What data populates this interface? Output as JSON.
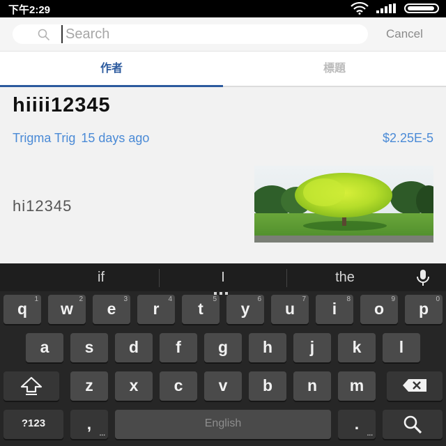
{
  "status_bar": {
    "time": "下午2:29"
  },
  "search": {
    "placeholder": "Search",
    "value": "",
    "cancel_label": "Cancel"
  },
  "tabs": [
    {
      "label": "作者",
      "selected": true
    },
    {
      "label": "標題",
      "selected": false
    }
  ],
  "post": {
    "title": "hiiii12345",
    "author": "Trigma Trig",
    "time_ago": "15 days ago",
    "price": "$2.25E-5",
    "excerpt": "hi12345",
    "thumbnail_icon": "tree-photo"
  },
  "keyboard": {
    "suggestions": [
      "if",
      "I",
      "the"
    ],
    "row1": [
      {
        "k": "q",
        "n": "1"
      },
      {
        "k": "w",
        "n": "2"
      },
      {
        "k": "e",
        "n": "3"
      },
      {
        "k": "r",
        "n": "4"
      },
      {
        "k": "t",
        "n": "5"
      },
      {
        "k": "y",
        "n": "6"
      },
      {
        "k": "u",
        "n": "7"
      },
      {
        "k": "i",
        "n": "8"
      },
      {
        "k": "o",
        "n": "9"
      },
      {
        "k": "p",
        "n": "0"
      }
    ],
    "row2": [
      "a",
      "s",
      "d",
      "f",
      "g",
      "h",
      "j",
      "k",
      "l"
    ],
    "row3": [
      "z",
      "x",
      "c",
      "v",
      "b",
      "n",
      "m"
    ],
    "symbols_label": "?123",
    "comma_label": ",",
    "space_label": "English",
    "period_label": "."
  },
  "colors": {
    "accent": "#2c5a9e",
    "link": "#4a8ad6",
    "keyboard_bg": "#262626",
    "key_bg": "#4a4a4a"
  }
}
